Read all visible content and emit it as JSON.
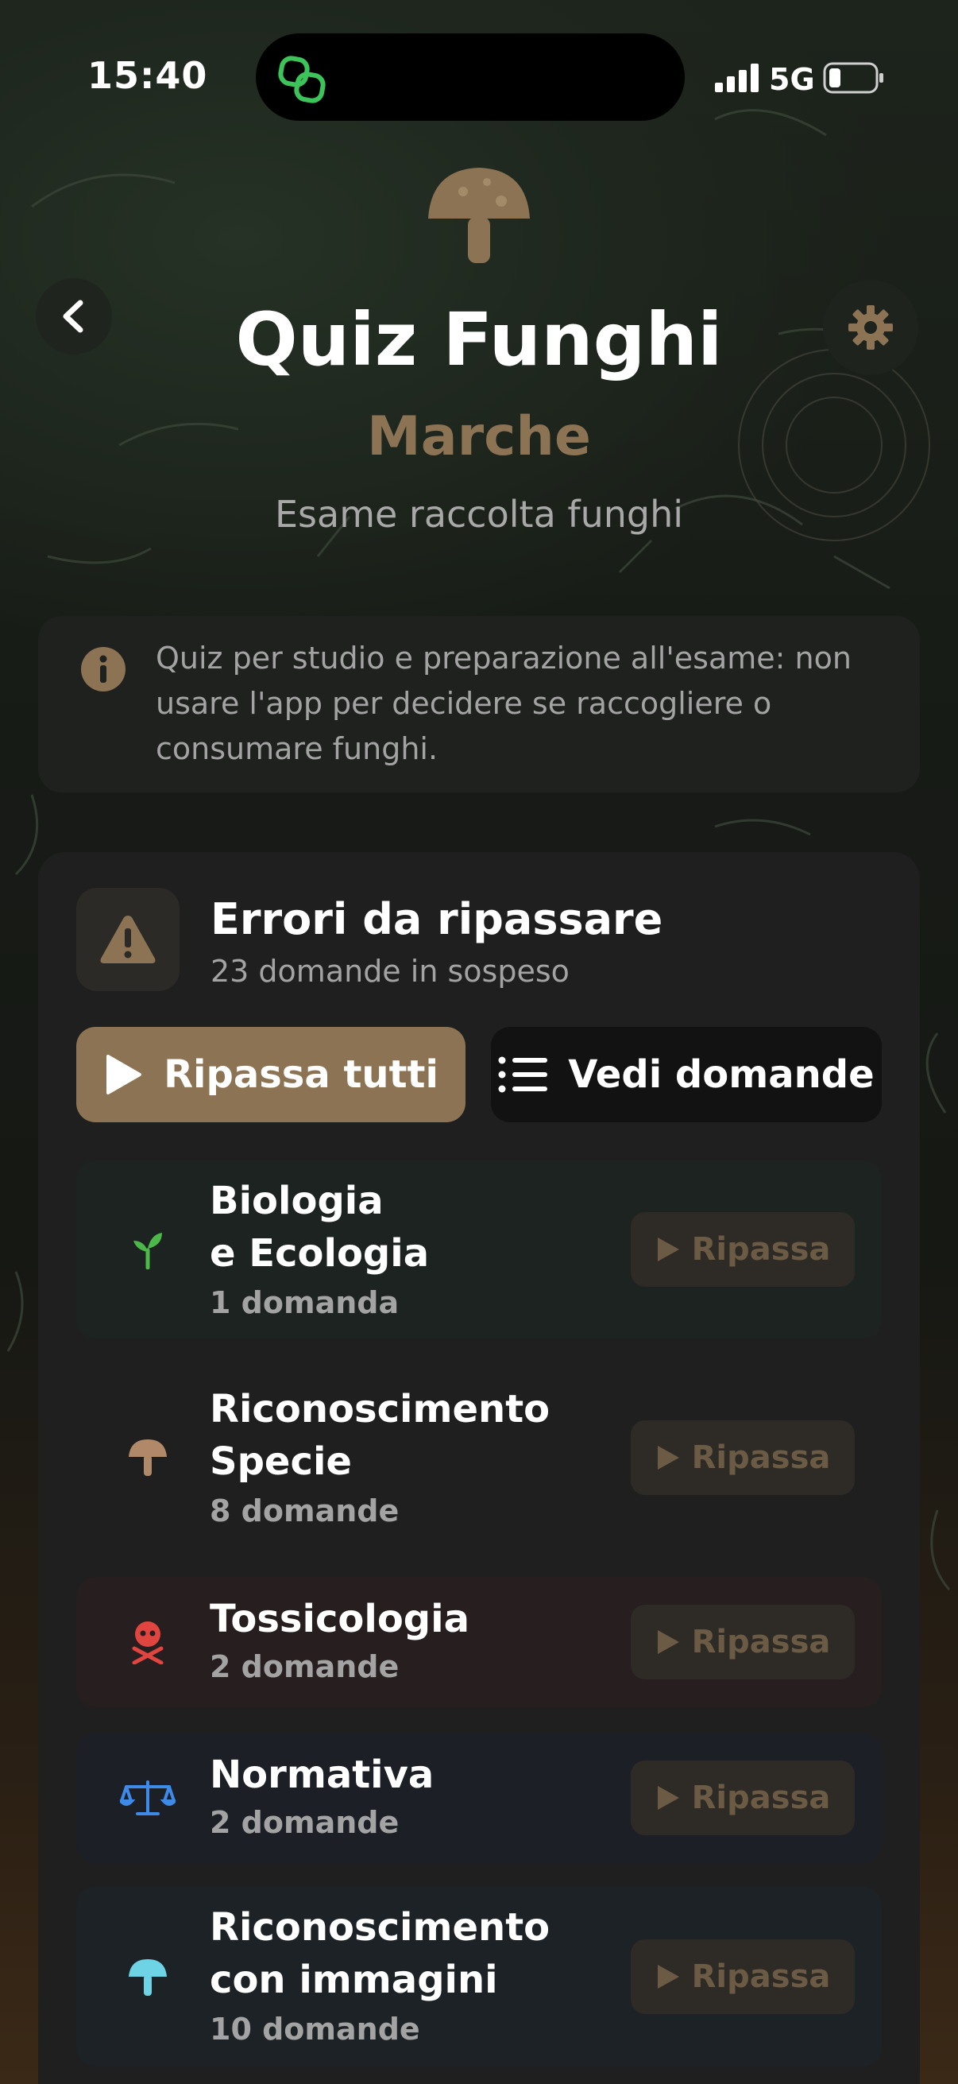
{
  "status_bar": {
    "time": "15:40",
    "network": "5G"
  },
  "header": {
    "title": "Quiz Funghi",
    "region": "Marche",
    "subtitle": "Esame raccolta funghi"
  },
  "notice": {
    "text": "Quiz per studio e preparazione all'esame: non usare l'app per decidere se raccogliere o consumare funghi."
  },
  "errors_card": {
    "title": "Errori da ripassare",
    "subtitle": "23 domande in sospeso",
    "review_all_label": "Ripassa tutti",
    "view_questions_label": "Vedi domande",
    "categories": [
      {
        "title": "Biologia\ne Ecologia",
        "count": "1 domanda",
        "icon": "sprout-icon",
        "review_label": "Ripassa"
      },
      {
        "title": "Riconoscimento\nSpecie",
        "count": "8 domande",
        "icon": "mushroom-icon",
        "review_label": "Ripassa"
      },
      {
        "title": "Tossicologia",
        "count": "2 domande",
        "icon": "skull-crossbones-icon",
        "review_label": "Ripassa"
      },
      {
        "title": "Normativa",
        "count": "2 domande",
        "icon": "scales-icon",
        "review_label": "Ripassa"
      },
      {
        "title": "Riconoscimento\ncon immagini",
        "count": "10 domande",
        "icon": "mushroom-blue-icon",
        "review_label": "Ripassa"
      }
    ]
  },
  "colors": {
    "accent": "#8c7354",
    "background": "#151813",
    "card": "#1f1f20"
  }
}
